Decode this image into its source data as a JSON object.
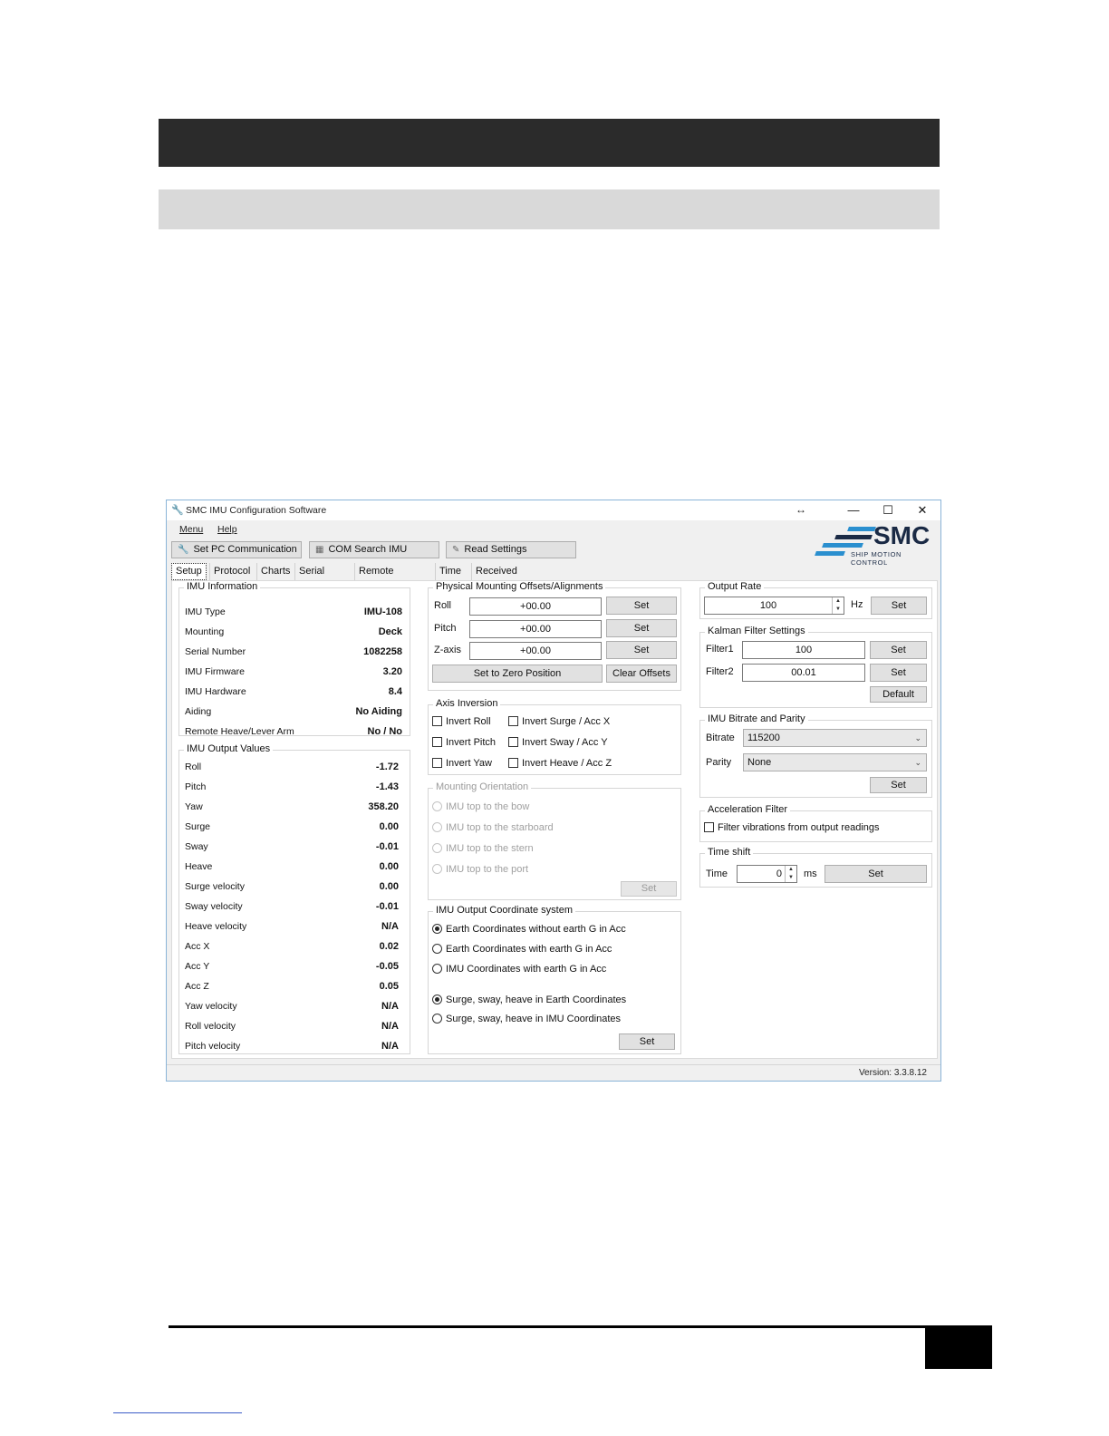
{
  "window": {
    "title": "SMC IMU Configuration Software",
    "resize_glyph": "↔",
    "minimize": "—",
    "maximize": "☐",
    "close": "✕"
  },
  "menu": {
    "items": [
      "Menu",
      "Help"
    ]
  },
  "toolbar": {
    "set_pc_communication": "Set PC Communication",
    "com_search_imu": "COM Search IMU",
    "read_settings": "Read Settings"
  },
  "logo": {
    "text": "SMC",
    "tagline": "SHIP MOTION CONTROL"
  },
  "tabs": [
    "Setup",
    "Protocol",
    "Charts",
    "Serial Input",
    "Remote Heave",
    "Time",
    "Received Data"
  ],
  "active_tab": "Setup",
  "imu_information": {
    "title": "IMU Information",
    "rows": [
      {
        "label": "IMU Type",
        "value": "IMU-108"
      },
      {
        "label": "Mounting",
        "value": "Deck"
      },
      {
        "label": "Serial Number",
        "value": "1082258"
      },
      {
        "label": "IMU Firmware",
        "value": "3.20"
      },
      {
        "label": "IMU Hardware",
        "value": "8.4"
      },
      {
        "label": "Aiding",
        "value": "No Aiding"
      },
      {
        "label": "Remote Heave/Lever Arm",
        "value": "No / No"
      }
    ]
  },
  "imu_output_values": {
    "title": "IMU Output Values",
    "rows": [
      {
        "label": "Roll",
        "value": "-1.72"
      },
      {
        "label": "Pitch",
        "value": "-1.43"
      },
      {
        "label": "Yaw",
        "value": "358.20"
      },
      {
        "label": "Surge",
        "value": "0.00"
      },
      {
        "label": "Sway",
        "value": "-0.01"
      },
      {
        "label": "Heave",
        "value": "0.00"
      },
      {
        "label": "Surge velocity",
        "value": "0.00"
      },
      {
        "label": "Sway velocity",
        "value": "-0.01"
      },
      {
        "label": "Heave velocity",
        "value": "N/A"
      },
      {
        "label": "Acc X",
        "value": "0.02"
      },
      {
        "label": "Acc Y",
        "value": "-0.05"
      },
      {
        "label": "Acc Z",
        "value": "0.05"
      },
      {
        "label": "Yaw velocity",
        "value": "N/A"
      },
      {
        "label": "Roll velocity",
        "value": "N/A"
      },
      {
        "label": "Pitch velocity",
        "value": "N/A"
      }
    ]
  },
  "mounting_offsets": {
    "title": "Physical Mounting Offsets/Alignments",
    "rows": [
      {
        "label": "Roll",
        "value": "+00.00",
        "button": "Set"
      },
      {
        "label": "Pitch",
        "value": "+00.00",
        "button": "Set"
      },
      {
        "label": "Z-axis",
        "value": "+00.00",
        "button": "Set"
      }
    ],
    "set_zero": "Set to Zero Position",
    "clear_offsets": "Clear Offsets"
  },
  "axis_inversion": {
    "title": "Axis Inversion",
    "items": [
      "Invert Roll",
      "Invert Surge / Acc X",
      "Invert Pitch",
      "Invert Sway / Acc Y",
      "Invert Yaw",
      "Invert Heave / Acc Z"
    ]
  },
  "mounting_orientation": {
    "title": "Mounting Orientation",
    "options": [
      "IMU top to the bow",
      "IMU top to the starboard",
      "IMU top to the stern",
      "IMU top to the port"
    ],
    "button": "Set"
  },
  "coordinate_system": {
    "title": "IMU Output Coordinate system",
    "options": [
      {
        "label": "Earth Coordinates without earth G in Acc",
        "selected": true
      },
      {
        "label": "Earth Coordinates with earth G in Acc",
        "selected": false
      },
      {
        "label": "IMU Coordinates with earth G in Acc",
        "selected": false
      }
    ],
    "options2": [
      {
        "label": "Surge, sway, heave in Earth Coordinates",
        "selected": true
      },
      {
        "label": "Surge, sway, heave in IMU Coordinates",
        "selected": false
      }
    ],
    "button": "Set"
  },
  "output_rate": {
    "title": "Output Rate",
    "value": "100",
    "unit": "Hz",
    "button": "Set"
  },
  "kalman": {
    "title": "Kalman Filter Settings",
    "filter1_label": "Filter1",
    "filter1_value": "100",
    "filter2_label": "Filter2",
    "filter2_value": "00.01",
    "set": "Set",
    "default": "Default"
  },
  "bitrate": {
    "title": "IMU Bitrate and Parity",
    "bitrate_label": "Bitrate",
    "bitrate_value": "115200",
    "parity_label": "Parity",
    "parity_value": "None",
    "button": "Set"
  },
  "accel_filter": {
    "title": "Acceleration Filter",
    "checkbox": "Filter vibrations from output readings"
  },
  "time_shift": {
    "title": "Time shift",
    "label": "Time",
    "value": "0",
    "unit": "ms",
    "button": "Set"
  },
  "status": {
    "version": "Version: 3.3.8.12"
  }
}
